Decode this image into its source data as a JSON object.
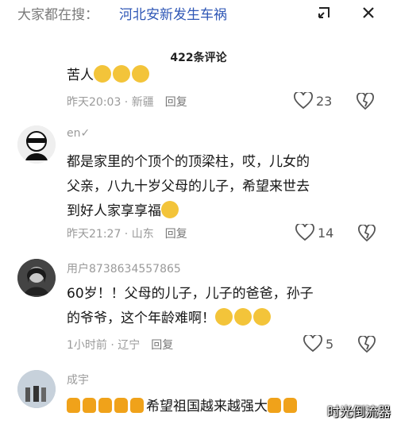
{
  "header": {
    "search_prefix": "大家都在搜：",
    "search_term": "河北安新发生车祸",
    "count_label": "422条评论"
  },
  "comments": [
    {
      "text": "苦人",
      "emoji": [
        "grimace",
        "grimace",
        "grimace"
      ],
      "time": "昨天20:03",
      "location": "新疆",
      "reply": "回复",
      "likes": "23"
    },
    {
      "user": "en✓",
      "text_lines": [
        "都是家里的个顶个的顶梁柱，哎，儿女的",
        "父亲，八九十岁父母的儿子，希望来世去",
        "到好人家享享福"
      ],
      "emoji": [
        "crying"
      ],
      "time": "昨天21:27",
      "location": "山东",
      "reply": "回复",
      "likes": "14"
    },
    {
      "user": "用户8738634557865",
      "text_lines": [
        "60岁！！父母的儿子，儿子的爸爸，孙子",
        "的爷爷，这个年龄难啊！"
      ],
      "emoji": [
        "dizzy",
        "dizzy",
        "dizzy"
      ],
      "time": "1小时前",
      "location": "辽宁",
      "reply": "回复",
      "likes": "5"
    },
    {
      "user": "成宇",
      "text": "希望祖国越来越强大",
      "emoji": [
        "thumbs-up"
      ]
    }
  ],
  "watermark": "时光倒流器",
  "colors": {
    "link": "#2f57b6",
    "meta": "#9a9a9a",
    "emoji_yellow": "#f3c43a",
    "thumb": "#f0a21a"
  }
}
